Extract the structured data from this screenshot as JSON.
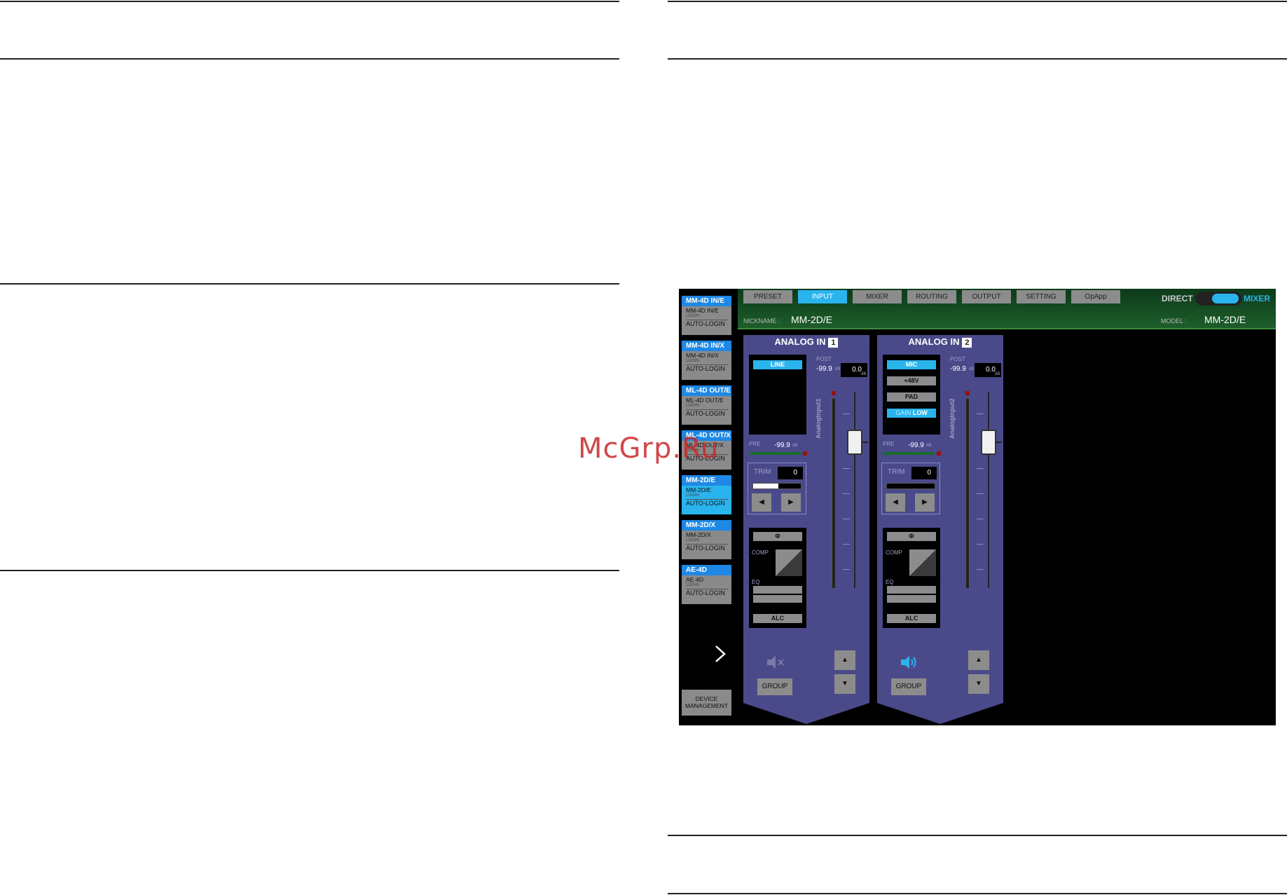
{
  "watermark": "McGrp.Ru",
  "sidebar": {
    "devices": [
      {
        "header": "MM-4D IN/E",
        "name": "MM-4D IN/E",
        "login": "LOGIN",
        "auto": "AUTO-LOGIN"
      },
      {
        "header": "MM-4D IN/X",
        "name": "MM-4D IN/X",
        "login": "LOGIN",
        "auto": "AUTO-LOGIN"
      },
      {
        "header": "ML-4D OUT/E",
        "name": "ML-4D OUT/E",
        "login": "LOGIN",
        "auto": "AUTO-LOGIN"
      },
      {
        "header": "ML-4D OUT/X",
        "name": "ML-4D OUT/X",
        "login": "LOGIN",
        "auto": "AUTO-LOGIN"
      },
      {
        "header": "MM-2D/E",
        "name": "MM-2D/E",
        "login": "LOGIN",
        "auto": "AUTO-LOGIN"
      },
      {
        "header": "MM-2D/X",
        "name": "MM-2D/X",
        "login": "LOGIN",
        "auto": "AUTO-LOGIN"
      },
      {
        "header": "AE-4D",
        "name": "AE-4D",
        "login": "LOGIN",
        "auto": "AUTO-LOGIN"
      }
    ],
    "device_management_line1": "DEVICE",
    "device_management_line2": "MANAGEMENT"
  },
  "tabs": [
    "PRESET",
    "INPUT",
    "MIXER",
    "ROUTING",
    "OUTPUT",
    "SETTING",
    "OpApp"
  ],
  "mode": {
    "left": "DIRECT",
    "right": "MIXER"
  },
  "nickname": {
    "label": "NICKNAME :",
    "value": "MM-2D/E"
  },
  "model": {
    "label": "MODEL :",
    "value": "MM-2D/E"
  },
  "channels": [
    {
      "title": "ANALOG IN",
      "number": "1",
      "buttons": [
        "LINE"
      ],
      "post_label": "POST",
      "post_value": "-99.9",
      "post_unit": "dB",
      "fader_value": "0.0",
      "fader_unit": "dB",
      "vertical_label": "AnalogInput1",
      "pre_label": "PRE",
      "pre_value": "-99.9",
      "pre_unit": "dB",
      "trim_label": "TRIM",
      "trim_value": "0",
      "phase": "Φ",
      "comp": "COMP",
      "eq": "EQ",
      "alc": "ALC",
      "group": "GROUP"
    },
    {
      "title": "ANALOG IN",
      "number": "2",
      "buttons": [
        "MIC",
        "+48V",
        "PAD"
      ],
      "gain_label": "GAIN",
      "gain_value": "LOW",
      "post_label": "POST",
      "post_value": "-99.9",
      "post_unit": "dB",
      "fader_value": "0.0",
      "fader_unit": "dB",
      "vertical_label": "AnalogInput2",
      "pre_label": "PRE",
      "pre_value": "-99.9",
      "pre_unit": "dB",
      "trim_label": "TRIM",
      "trim_value": "0",
      "phase": "Φ",
      "comp": "COMP",
      "eq": "EQ",
      "alc": "ALC",
      "group": "GROUP"
    }
  ],
  "colors": {
    "accent": "#2ab4ee",
    "strip": "#4a4a8a",
    "device_header": "#1e88e5"
  }
}
